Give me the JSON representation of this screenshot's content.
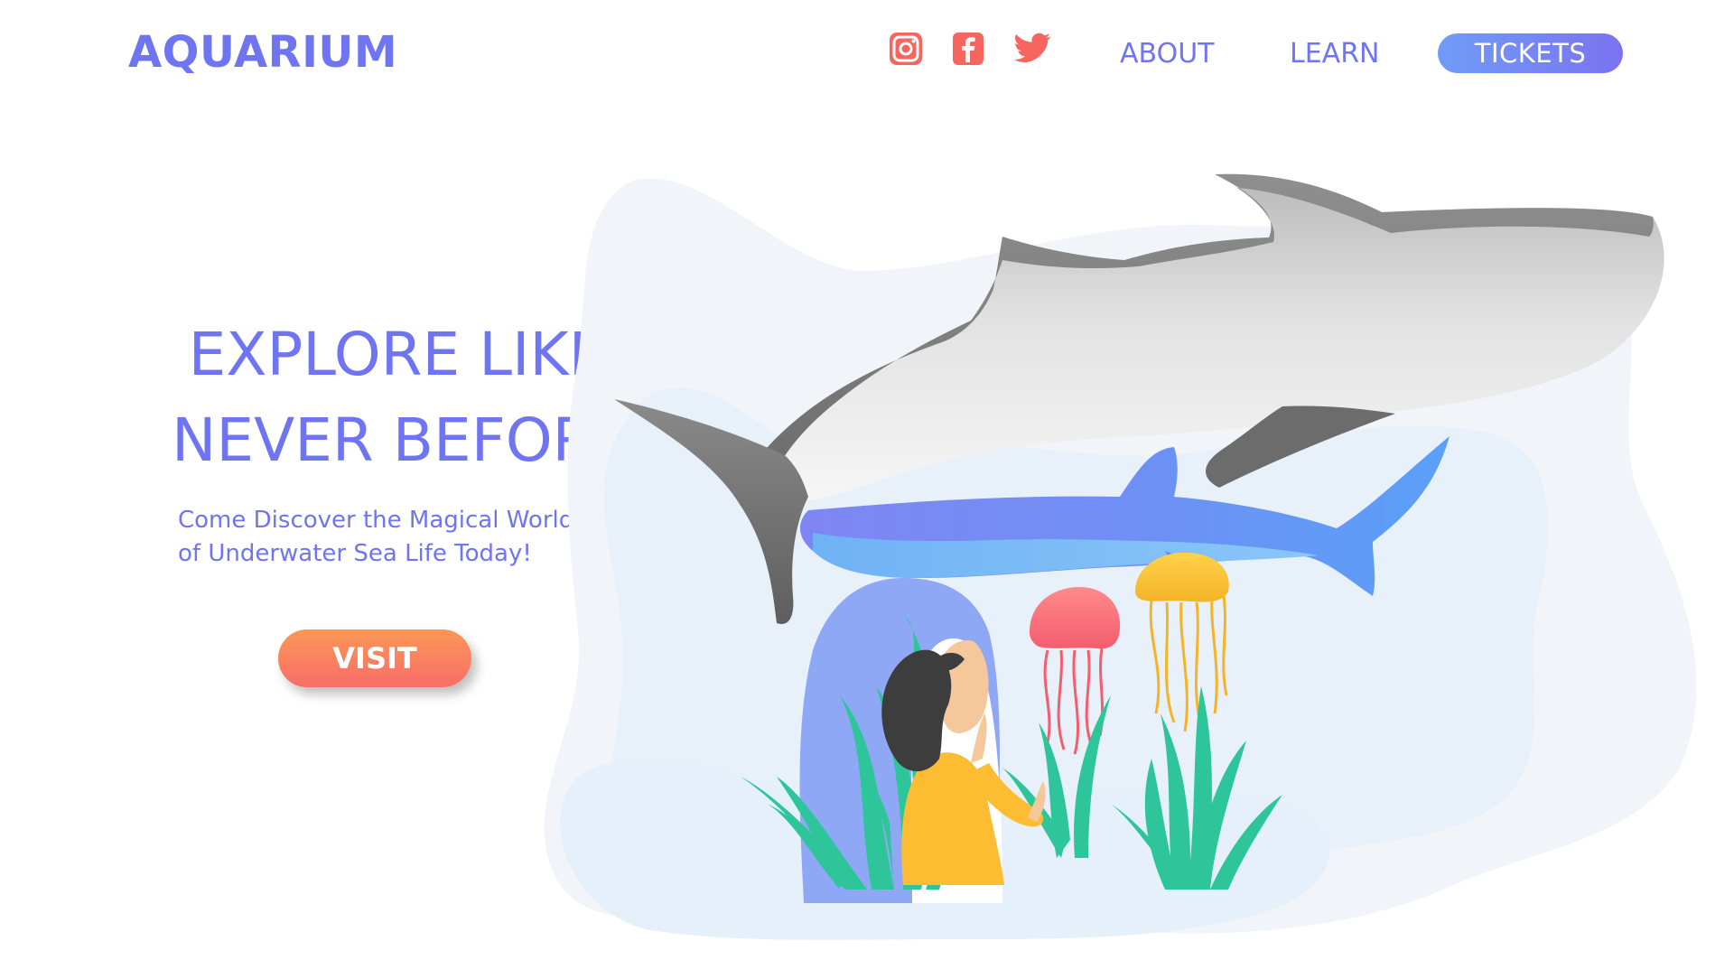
{
  "header": {
    "logo": "AQUARIUM",
    "social_icons": [
      "instagram-icon",
      "facebook-icon",
      "twitter-icon"
    ],
    "nav": {
      "about": "ABOUT",
      "learn": "LEARN",
      "tickets": "TICKETS"
    }
  },
  "hero": {
    "title_line1": "EXPLORE LIKE",
    "title_line2": "NEVER BEFORE",
    "subtitle_line1": "Come Discover the Magical World",
    "subtitle_line2": "of Underwater Sea Life Today!",
    "cta": "VISIT"
  },
  "colors": {
    "primary": "#6f74f1",
    "social": "#f7655f",
    "cta_top": "#fb9756",
    "cta_bottom": "#f86e68",
    "tickets_left": "#6f9cf8",
    "tickets_right": "#7b73f0"
  }
}
